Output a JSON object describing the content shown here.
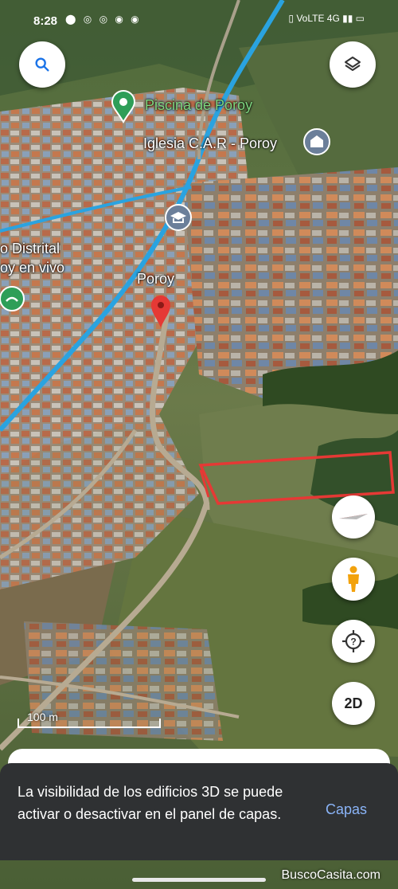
{
  "status_bar": {
    "time": "8:28",
    "icons": "⬤ ◎ ◎ ◉ ◉",
    "right": "▯ VoLTE 4G ▮▮ ▭"
  },
  "map": {
    "labels": {
      "piscina": "Piscina de Poroy",
      "iglesia": "Iglesia C.A.R - Poroy",
      "distrital_1": "o Distrital",
      "distrital_2": "oy en vivo",
      "poroy": "Poroy"
    },
    "scale": "100 m"
  },
  "controls": {
    "compass": "compass-icon",
    "twod": "2D"
  },
  "snackbar": {
    "text": "La visibilidad de los edificios 3D se puede activar o desactivar en el panel de capas.",
    "action": "Capas"
  },
  "watermark": "BuscoCasita.com",
  "colors": {
    "accent_blue": "#8ab4f8",
    "highlight_red": "#e53935",
    "pin_green": "#2e9e58",
    "pin_red": "#e53935",
    "canal_blue": "#2aa3e0"
  }
}
